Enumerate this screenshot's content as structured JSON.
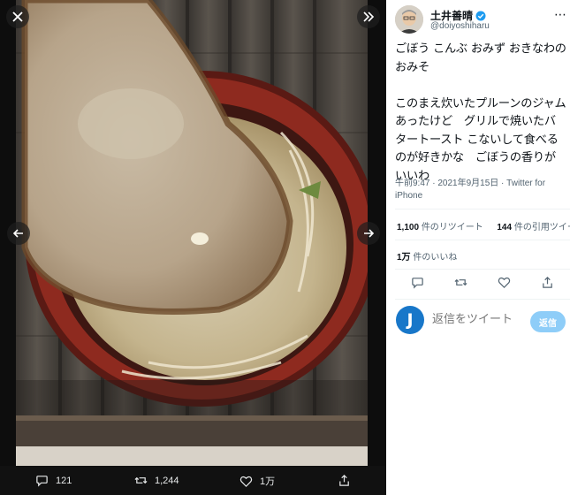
{
  "viewer": {
    "close_icon": "close-icon",
    "expand_icon": "chevrons-right-icon",
    "prev_icon": "arrow-left-icon",
    "next_icon": "arrow-right-icon",
    "actions": {
      "reply_count": "121",
      "retweet_count": "1,244",
      "like_count": "1万"
    }
  },
  "tweet": {
    "author_name": "土井善晴",
    "author_handle": "@doiyoshiharu",
    "text": "ごぼう こんぶ おみず おきなわのおみそ\n\nこのまえ炊いたプルーンのジャムあったけど　グリルで焼いたバタートースト こないして食べるのが好きかな　ごぼうの香りがいいわ",
    "meta": "午前9:47 · 2021年9月15日 · Twitter for iPhone",
    "retweets_value": "1,100",
    "retweets_label": "件のリツイート",
    "quotes_value": "144",
    "quotes_label": "件の引用ツイート",
    "likes_value": "1万",
    "likes_label": "件のいいね"
  },
  "reply": {
    "avatar_letter": "J",
    "placeholder": "返信をツイート",
    "button_label": "返信"
  },
  "colors": {
    "accent": "#1d9bf0",
    "reply_button": "#8ecdf8",
    "verified": "#1d9bf0"
  }
}
